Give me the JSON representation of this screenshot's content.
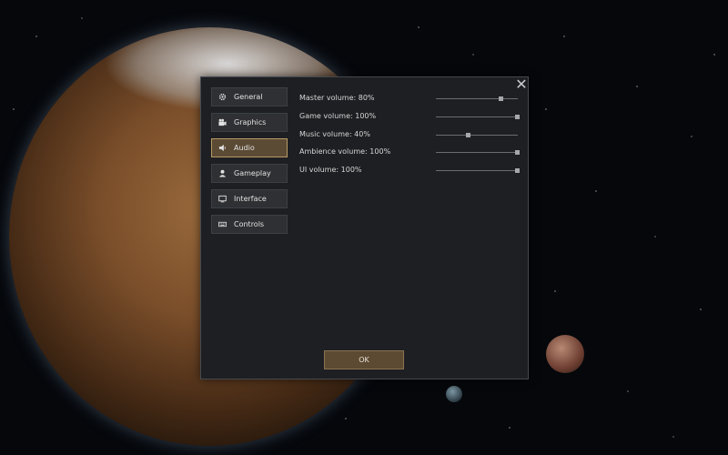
{
  "dialog": {
    "close_symbol": "✕",
    "ok_label": "OK"
  },
  "tabs": [
    {
      "label": "General",
      "icon": "gear-icon",
      "active": false
    },
    {
      "label": "Graphics",
      "icon": "camera-icon",
      "active": false
    },
    {
      "label": "Audio",
      "icon": "speaker-icon",
      "active": true
    },
    {
      "label": "Gameplay",
      "icon": "person-icon",
      "active": false
    },
    {
      "label": "Interface",
      "icon": "monitor-icon",
      "active": false
    },
    {
      "label": "Controls",
      "icon": "keyboard-icon",
      "active": false
    }
  ],
  "settings": [
    {
      "label": "Master volume: 80%",
      "value": 0.8
    },
    {
      "label": "Game volume: 100%",
      "value": 1.0
    },
    {
      "label": "Music volume: 40%",
      "value": 0.4
    },
    {
      "label": "Ambience volume: 100%",
      "value": 1.0
    },
    {
      "label": "UI volume: 100%",
      "value": 1.0
    }
  ],
  "colors": {
    "accent": "#b89a64",
    "active_tab_bg": "#5b4a34",
    "panel_bg": "#1d1f22"
  }
}
